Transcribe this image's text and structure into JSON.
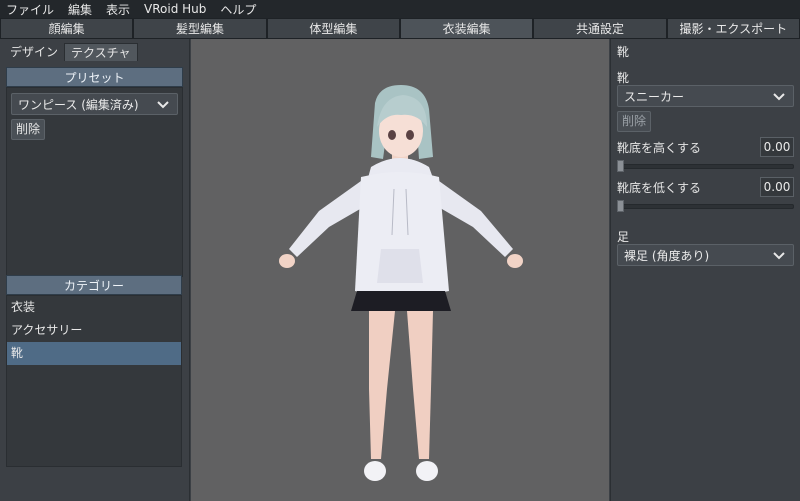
{
  "menu": [
    "ファイル",
    "編集",
    "表示",
    "VRoid Hub",
    "ヘルプ"
  ],
  "tabs": [
    {
      "label": "顔編集",
      "active": false
    },
    {
      "label": "髪型編集",
      "active": false
    },
    {
      "label": "体型編集",
      "active": false
    },
    {
      "label": "衣装編集",
      "active": true
    },
    {
      "label": "共通設定",
      "active": false
    },
    {
      "label": "撮影・エクスポート",
      "active": false
    }
  ],
  "left": {
    "subtabs": [
      "デザイン",
      "テクスチャ"
    ],
    "preset_header": "プリセット",
    "preset_value": "ワンピース (編集済み)",
    "delete_label": "削除",
    "category_header": "カテゴリー",
    "categories": [
      "衣装",
      "アクセサリー",
      "靴"
    ],
    "active_category_index": 2
  },
  "right": {
    "title": "靴",
    "shoes_label": "靴",
    "shoes_value": "スニーカー",
    "delete_label": "削除",
    "sole_high_label": "靴底を高くする",
    "sole_high_value": "0.00",
    "sole_low_label": "靴底を低くする",
    "sole_low_value": "0.00",
    "foot_label": "足",
    "foot_value": "裸足 (角度あり)"
  },
  "colors": {
    "accent": "#4f6b86",
    "viewport_bg": "#616162"
  }
}
